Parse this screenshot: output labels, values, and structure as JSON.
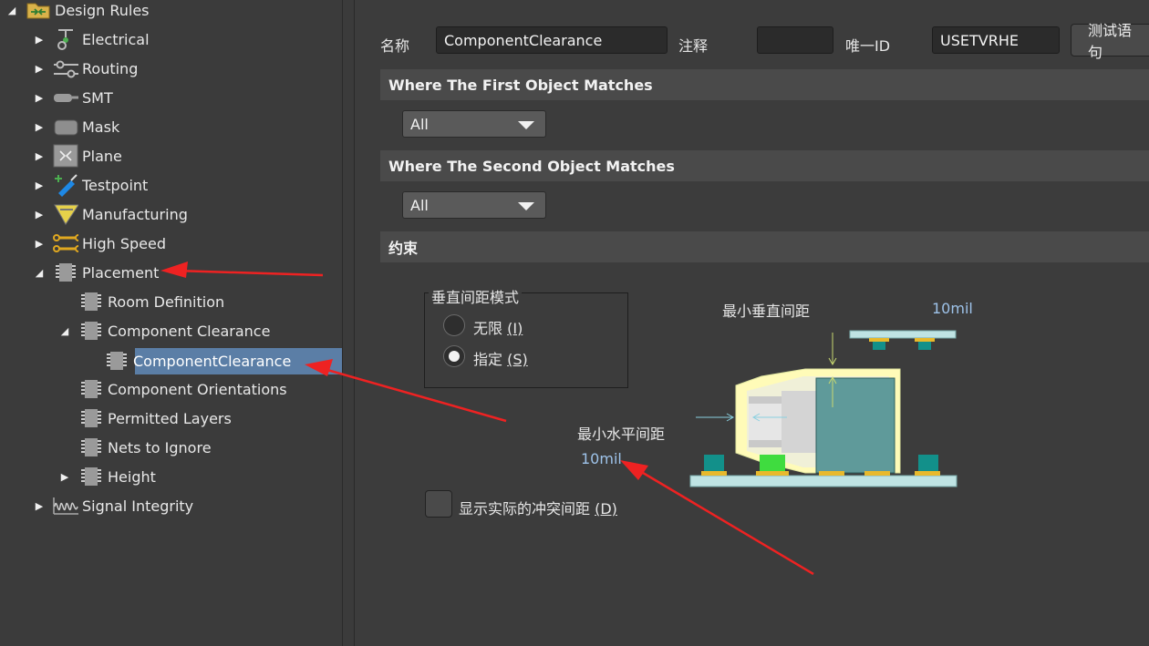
{
  "tree": {
    "root": "Design Rules",
    "items": [
      {
        "label": "Electrical",
        "icon": "electrical-icon"
      },
      {
        "label": "Routing",
        "icon": "routing-icon"
      },
      {
        "label": "SMT",
        "icon": "smt-icon"
      },
      {
        "label": "Mask",
        "icon": "mask-icon"
      },
      {
        "label": "Plane",
        "icon": "plane-icon"
      },
      {
        "label": "Testpoint",
        "icon": "testpoint-icon"
      },
      {
        "label": "Manufacturing",
        "icon": "manufacturing-icon"
      },
      {
        "label": "High Speed",
        "icon": "high-speed-icon"
      },
      {
        "label": "Placement",
        "icon": "chip-icon"
      },
      {
        "label": "Room Definition",
        "icon": "chip-icon"
      },
      {
        "label": "Component Clearance",
        "icon": "chip-icon"
      },
      {
        "label": "ComponentClearance",
        "icon": "chip-icon"
      },
      {
        "label": "Component Orientations",
        "icon": "chip-icon"
      },
      {
        "label": "Permitted Layers",
        "icon": "chip-icon"
      },
      {
        "label": "Nets to Ignore",
        "icon": "chip-icon"
      },
      {
        "label": "Height",
        "icon": "chip-icon"
      },
      {
        "label": "Signal Integrity",
        "icon": "signal-integrity-icon"
      }
    ]
  },
  "header": {
    "name_label": "名称",
    "name_value": "ComponentClearance",
    "comment_label": "注释",
    "comment_value": "",
    "uid_label": "唯一ID",
    "uid_value": "USETVRHE",
    "test_button": "测试语句"
  },
  "first_match": {
    "title": "Where The First Object Matches",
    "value": "All"
  },
  "second_match": {
    "title": "Where The Second Object Matches",
    "value": "All"
  },
  "constraints": {
    "title": "约束",
    "mode_group": "垂直间距模式",
    "opt_infinite": "无限",
    "opt_infinite_key": "(I)",
    "opt_specified": "指定",
    "opt_specified_key": "(S)",
    "selected": "指定",
    "min_vertical_label": "最小垂直间距",
    "min_vertical_value": "10mil",
    "min_horizontal_label": "最小水平间距",
    "min_horizontal_value": "10mil",
    "show_actual_label": "显示实际的冲突间距",
    "show_actual_key": "(D)",
    "show_actual_checked": false
  },
  "colors": {
    "annotation_arrow": "#ee2222",
    "selection": "#5b7ea6",
    "value_blue": "#9ec3ea"
  }
}
